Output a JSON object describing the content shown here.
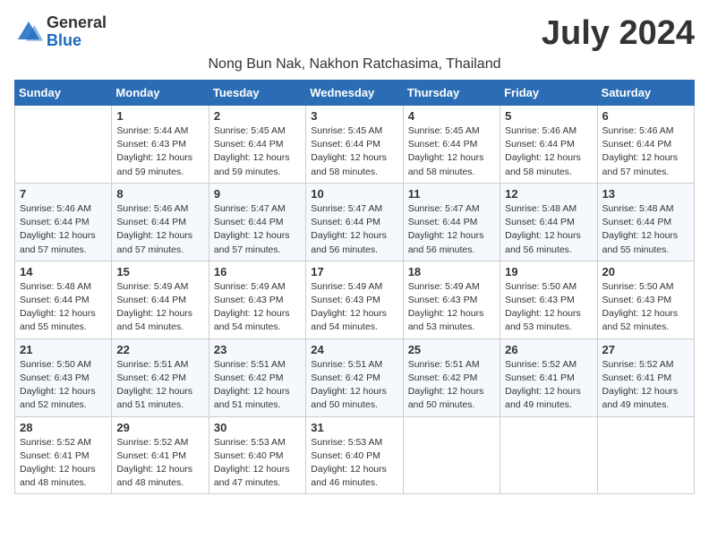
{
  "header": {
    "logo_general": "General",
    "logo_blue": "Blue",
    "month_title": "July 2024",
    "subtitle": "Nong Bun Nak, Nakhon Ratchasima, Thailand"
  },
  "weekdays": [
    "Sunday",
    "Monday",
    "Tuesday",
    "Wednesday",
    "Thursday",
    "Friday",
    "Saturday"
  ],
  "weeks": [
    [
      {
        "day": "",
        "info": ""
      },
      {
        "day": "1",
        "info": "Sunrise: 5:44 AM\nSunset: 6:43 PM\nDaylight: 12 hours\nand 59 minutes."
      },
      {
        "day": "2",
        "info": "Sunrise: 5:45 AM\nSunset: 6:44 PM\nDaylight: 12 hours\nand 59 minutes."
      },
      {
        "day": "3",
        "info": "Sunrise: 5:45 AM\nSunset: 6:44 PM\nDaylight: 12 hours\nand 58 minutes."
      },
      {
        "day": "4",
        "info": "Sunrise: 5:45 AM\nSunset: 6:44 PM\nDaylight: 12 hours\nand 58 minutes."
      },
      {
        "day": "5",
        "info": "Sunrise: 5:46 AM\nSunset: 6:44 PM\nDaylight: 12 hours\nand 58 minutes."
      },
      {
        "day": "6",
        "info": "Sunrise: 5:46 AM\nSunset: 6:44 PM\nDaylight: 12 hours\nand 57 minutes."
      }
    ],
    [
      {
        "day": "7",
        "info": "Sunrise: 5:46 AM\nSunset: 6:44 PM\nDaylight: 12 hours\nand 57 minutes."
      },
      {
        "day": "8",
        "info": "Sunrise: 5:46 AM\nSunset: 6:44 PM\nDaylight: 12 hours\nand 57 minutes."
      },
      {
        "day": "9",
        "info": "Sunrise: 5:47 AM\nSunset: 6:44 PM\nDaylight: 12 hours\nand 57 minutes."
      },
      {
        "day": "10",
        "info": "Sunrise: 5:47 AM\nSunset: 6:44 PM\nDaylight: 12 hours\nand 56 minutes."
      },
      {
        "day": "11",
        "info": "Sunrise: 5:47 AM\nSunset: 6:44 PM\nDaylight: 12 hours\nand 56 minutes."
      },
      {
        "day": "12",
        "info": "Sunrise: 5:48 AM\nSunset: 6:44 PM\nDaylight: 12 hours\nand 56 minutes."
      },
      {
        "day": "13",
        "info": "Sunrise: 5:48 AM\nSunset: 6:44 PM\nDaylight: 12 hours\nand 55 minutes."
      }
    ],
    [
      {
        "day": "14",
        "info": "Sunrise: 5:48 AM\nSunset: 6:44 PM\nDaylight: 12 hours\nand 55 minutes."
      },
      {
        "day": "15",
        "info": "Sunrise: 5:49 AM\nSunset: 6:44 PM\nDaylight: 12 hours\nand 54 minutes."
      },
      {
        "day": "16",
        "info": "Sunrise: 5:49 AM\nSunset: 6:43 PM\nDaylight: 12 hours\nand 54 minutes."
      },
      {
        "day": "17",
        "info": "Sunrise: 5:49 AM\nSunset: 6:43 PM\nDaylight: 12 hours\nand 54 minutes."
      },
      {
        "day": "18",
        "info": "Sunrise: 5:49 AM\nSunset: 6:43 PM\nDaylight: 12 hours\nand 53 minutes."
      },
      {
        "day": "19",
        "info": "Sunrise: 5:50 AM\nSunset: 6:43 PM\nDaylight: 12 hours\nand 53 minutes."
      },
      {
        "day": "20",
        "info": "Sunrise: 5:50 AM\nSunset: 6:43 PM\nDaylight: 12 hours\nand 52 minutes."
      }
    ],
    [
      {
        "day": "21",
        "info": "Sunrise: 5:50 AM\nSunset: 6:43 PM\nDaylight: 12 hours\nand 52 minutes."
      },
      {
        "day": "22",
        "info": "Sunrise: 5:51 AM\nSunset: 6:42 PM\nDaylight: 12 hours\nand 51 minutes."
      },
      {
        "day": "23",
        "info": "Sunrise: 5:51 AM\nSunset: 6:42 PM\nDaylight: 12 hours\nand 51 minutes."
      },
      {
        "day": "24",
        "info": "Sunrise: 5:51 AM\nSunset: 6:42 PM\nDaylight: 12 hours\nand 50 minutes."
      },
      {
        "day": "25",
        "info": "Sunrise: 5:51 AM\nSunset: 6:42 PM\nDaylight: 12 hours\nand 50 minutes."
      },
      {
        "day": "26",
        "info": "Sunrise: 5:52 AM\nSunset: 6:41 PM\nDaylight: 12 hours\nand 49 minutes."
      },
      {
        "day": "27",
        "info": "Sunrise: 5:52 AM\nSunset: 6:41 PM\nDaylight: 12 hours\nand 49 minutes."
      }
    ],
    [
      {
        "day": "28",
        "info": "Sunrise: 5:52 AM\nSunset: 6:41 PM\nDaylight: 12 hours\nand 48 minutes."
      },
      {
        "day": "29",
        "info": "Sunrise: 5:52 AM\nSunset: 6:41 PM\nDaylight: 12 hours\nand 48 minutes."
      },
      {
        "day": "30",
        "info": "Sunrise: 5:53 AM\nSunset: 6:40 PM\nDaylight: 12 hours\nand 47 minutes."
      },
      {
        "day": "31",
        "info": "Sunrise: 5:53 AM\nSunset: 6:40 PM\nDaylight: 12 hours\nand 46 minutes."
      },
      {
        "day": "",
        "info": ""
      },
      {
        "day": "",
        "info": ""
      },
      {
        "day": "",
        "info": ""
      }
    ]
  ]
}
